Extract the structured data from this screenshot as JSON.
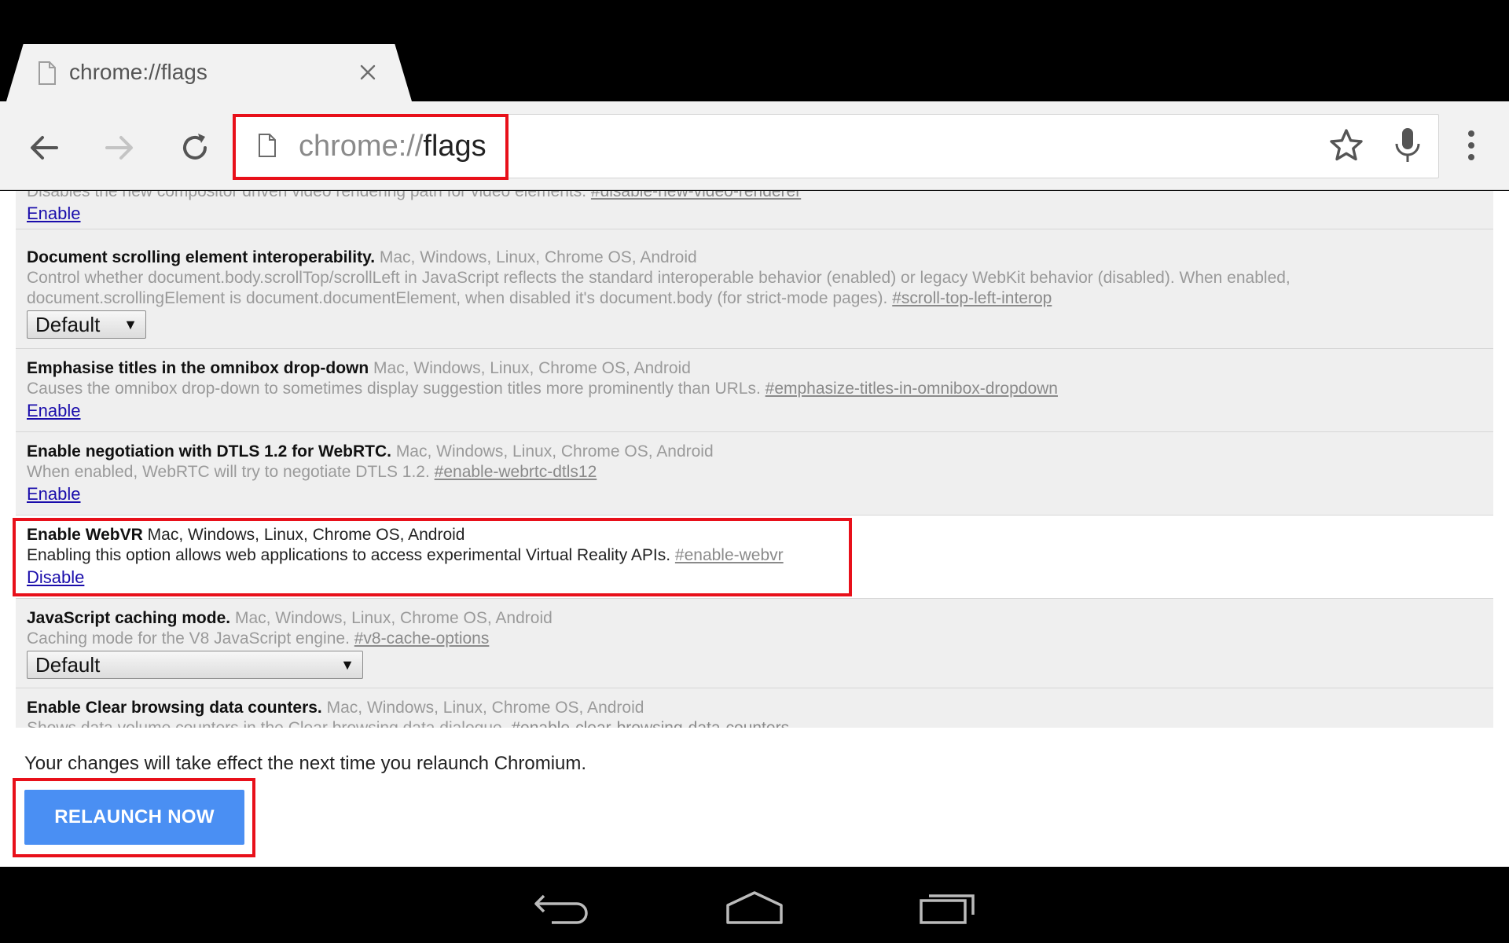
{
  "browser": {
    "tab": {
      "title": "chrome://flags"
    },
    "omnibox": {
      "scheme": "chrome://",
      "host": "flags"
    }
  },
  "flags": [
    {
      "name": "",
      "platforms": "",
      "description": "Disables the new compositor driven video rendering path for video elements.",
      "permalink": "#disable-new-video-renderer",
      "action": "Enable"
    },
    {
      "name": "Document scrolling element interoperability.",
      "platforms": "Mac, Windows, Linux, Chrome OS, Android",
      "description_line1": "Control whether document.body.scrollTop/scrollLeft in JavaScript reflects the standard interoperable behavior (enabled) or legacy WebKit behavior (disabled). When enabled,",
      "description_line2": "document.scrollingElement is document.documentElement, when disabled it's document.body (for strict-mode pages).",
      "permalink": "#scroll-top-left-interop",
      "select_value": "Default"
    },
    {
      "name": "Emphasise titles in the omnibox drop-down",
      "platforms": "Mac, Windows, Linux, Chrome OS, Android",
      "description": "Causes the omnibox drop-down to sometimes display suggestion titles more prominently than URLs.",
      "permalink": "#emphasize-titles-in-omnibox-dropdown",
      "action": "Enable"
    },
    {
      "name": "Enable negotiation with DTLS 1.2 for WebRTC.",
      "platforms": "Mac, Windows, Linux, Chrome OS, Android",
      "description": "When enabled, WebRTC will try to negotiate DTLS 1.2.",
      "permalink": "#enable-webrtc-dtls12",
      "action": "Enable"
    },
    {
      "name": "Enable WebVR",
      "platforms": "Mac, Windows, Linux, Chrome OS, Android",
      "description": "Enabling this option allows web applications to access experimental Virtual Reality APIs.",
      "permalink": "#enable-webvr",
      "action": "Disable",
      "state": "enabled"
    },
    {
      "name": "JavaScript caching mode.",
      "platforms": "Mac, Windows, Linux, Chrome OS, Android",
      "description": "Caching mode for the V8 JavaScript engine.",
      "permalink": "#v8-cache-options",
      "select_value": "Default"
    },
    {
      "name": "Enable Clear browsing data counters.",
      "platforms": "Mac, Windows, Linux, Chrome OS, Android",
      "description": "Shows data volume counters in the Clear browsing data dialogue.",
      "permalink": "#enable-clear-browsing-data-counters"
    }
  ],
  "footer": {
    "notice": "Your changes will take effect the next time you relaunch Chromium.",
    "relaunch_label": "RELAUNCH NOW"
  },
  "colors": {
    "highlight": "#e8101a",
    "relaunch_button": "#4a8ff3",
    "link": "#1a0dab"
  },
  "icons": {
    "tab": [
      "page-icon",
      "close-icon"
    ],
    "toolbar": [
      "back-arrow-icon",
      "forward-arrow-icon",
      "reload-icon",
      "page-icon",
      "star-icon",
      "microphone-icon",
      "overflow-menu-icon"
    ],
    "system_nav": [
      "nav-back-icon",
      "nav-home-icon",
      "nav-recents-icon"
    ]
  }
}
